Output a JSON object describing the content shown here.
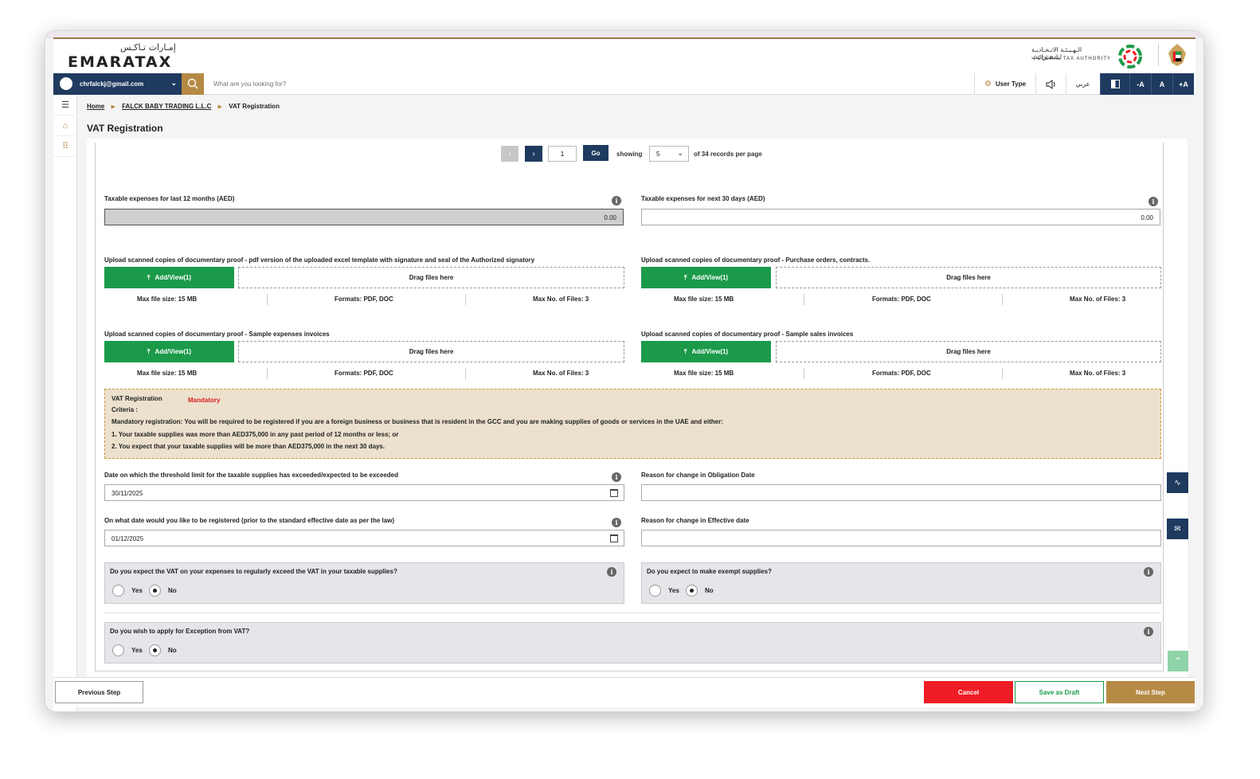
{
  "brand": {
    "logo_ar": "إمـارات تـاكـس",
    "logo_en": "EMARATAX",
    "fta_ar": "الـهـيـئـة الاتـحـاديـة لـلـضـرائـب",
    "fta_en": "FEDERAL TAX AUTHORITY"
  },
  "nav": {
    "user_email": "chrfalckj@gmail.com",
    "search_placeholder": "What are you looking for?",
    "user_type": "User Type",
    "lang": "عربي",
    "font_decrease": "-A",
    "font_normal": "A",
    "font_increase": "+A"
  },
  "breadcrumb": {
    "home": "Home",
    "company": "FALCK BABY TRADING L.L.C",
    "current": "VAT Registration"
  },
  "page_title": "VAT Registration",
  "pager": {
    "page": "1",
    "go": "Go",
    "showing": "showing",
    "per_page": "5",
    "records_text": "of 34 records per page"
  },
  "expenses": {
    "last12_label": "Taxable expenses for last 12 months (AED)",
    "last12_value": "0.00",
    "next30_label": "Taxable expenses for next 30 days (AED)",
    "next30_value": "0.00"
  },
  "uploads": [
    {
      "label": "Upload scanned copies of documentary proof - pdf version of the uploaded excel template with signature and seal of the Authorized signatory",
      "button": "Add/View(1)",
      "drop": "Drag files here",
      "max_size": "Max file size: 15 MB",
      "formats": "Formats: PDF, DOC",
      "max_files": "Max No. of Files: 3"
    },
    {
      "label": "Upload scanned copies of documentary proof - Purchase orders, contracts.",
      "button": "Add/View(1)",
      "drop": "Drag files here",
      "max_size": "Max file size: 15 MB",
      "formats": "Formats: PDF, DOC",
      "max_files": "Max No. of Files: 3"
    },
    {
      "label": "Upload scanned copies of documentary proof - Sample expenses invoices",
      "button": "Add/View(1)",
      "drop": "Drag files here",
      "max_size": "Max file size: 15 MB",
      "formats": "Formats: PDF, DOC",
      "max_files": "Max No. of Files: 3"
    },
    {
      "label": "Upload scanned copies of documentary proof - Sample sales invoices",
      "button": "Add/View(1)",
      "drop": "Drag files here",
      "max_size": "Max file size: 15 MB",
      "formats": "Formats: PDF, DOC",
      "max_files": "Max No. of Files: 3"
    }
  ],
  "notice": {
    "title": "VAT Registration",
    "status": "Mandatory",
    "criteria": "Criteria :",
    "line1": "Mandatory registration: You will be required to be registered if you are a foreign business or business that is resident in the GCC and you are making supplies of goods or services in the UAE and either:",
    "line2": "1. Your taxable supplies was more than AED375,000 in any past period of 12 months or less; or",
    "line3": "2. You expect that your taxable supplies will be more than AED375,000 in the next 30 days."
  },
  "dates": {
    "threshold_label": "Date on which the threshold limit for the taxable supplies has exceeded/expected to be exceeded",
    "threshold_value": "30/11/2025",
    "obligation_reason_label": "Reason for change in Obligation Date",
    "register_label": "On what date would you like to be registered (prior to the standard effective date as per the law)",
    "register_value": "01/12/2025",
    "effective_reason_label": "Reason for change in Effective date"
  },
  "questions": {
    "q1": "Do you expect the VAT on your expenses to regularly exceed the VAT in your taxable supplies?",
    "q2": "Do you expect to make exempt supplies?",
    "q3": "Do you wish to apply for Exception from VAT?",
    "yes": "Yes",
    "no": "No"
  },
  "footer": {
    "previous": "Previous Step",
    "cancel": "Cancel",
    "save_draft": "Save as Draft",
    "next": "Next Step"
  },
  "colors": {
    "navy": "#1f3a5f",
    "gold": "#b68a45",
    "green": "#1b9a4a",
    "red": "#ee1c25",
    "notice_bg": "#ece1cd"
  }
}
